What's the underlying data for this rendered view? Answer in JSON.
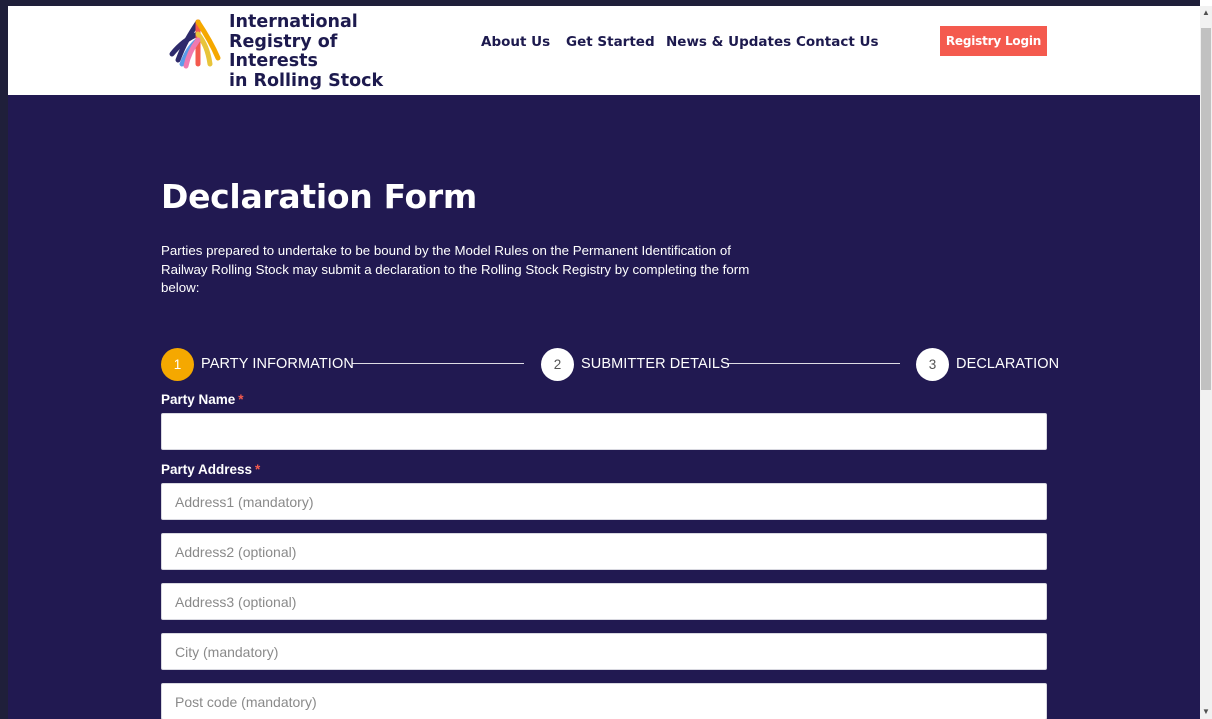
{
  "header": {
    "brand_line1": "International",
    "brand_line2": "Registry of Interests",
    "brand_line3": "in Rolling Stock",
    "nav": {
      "about": "About Us",
      "get_started": "Get Started",
      "news": "News & Updates",
      "contact": "Contact Us"
    },
    "login_label": "Registry Login"
  },
  "colors": {
    "primary_dark": "#211951",
    "accent": "#f45a4e",
    "step_active": "#f5a800"
  },
  "page": {
    "title": "Declaration Form",
    "intro": "Parties prepared to undertake to be bound by the Model Rules on the Permanent Identification of Railway Rolling Stock may submit a declaration to the Rolling Stock Registry by completing the form below:"
  },
  "stepper": {
    "steps": [
      {
        "number": "1",
        "label": "PARTY INFORMATION",
        "active": true
      },
      {
        "number": "2",
        "label": "SUBMITTER DETAILS",
        "active": false
      },
      {
        "number": "3",
        "label": "DECLARATION",
        "active": false
      }
    ]
  },
  "form": {
    "required_marker": "*",
    "party_name_label": "Party Name",
    "party_name_value": "",
    "party_address_label": "Party Address",
    "address1_placeholder": "Address1 (mandatory)",
    "address2_placeholder": "Address2 (optional)",
    "address3_placeholder": "Address3 (optional)",
    "city_placeholder": "City (mandatory)",
    "postcode_placeholder": "Post code (mandatory)"
  },
  "icons": {
    "logo": "rail-fork-logo",
    "scroll_up": "arrow-up-icon",
    "scroll_down": "arrow-down-icon"
  }
}
